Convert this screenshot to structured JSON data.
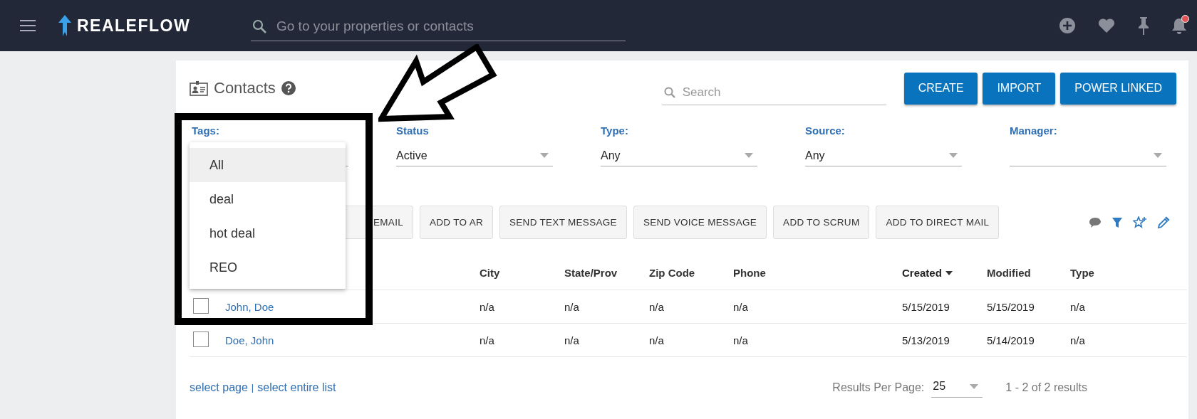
{
  "topbar": {
    "logo": "REALEFLOW",
    "search": {
      "placeholder": "Go to your properties or contacts"
    }
  },
  "page": {
    "title": "Contacts",
    "search": {
      "placeholder": "Search"
    },
    "buttons": [
      "CREATE",
      "IMPORT",
      "POWER LINKED"
    ],
    "filters": [
      {
        "label": "Tags:",
        "options": [
          {
            "label": "All",
            "selected": true
          },
          {
            "label": "deal",
            "selected": false
          },
          {
            "label": "hot deal",
            "selected": false
          },
          {
            "label": "REO",
            "selected": false
          }
        ]
      },
      {
        "label": "Status",
        "value": "Active"
      },
      {
        "label": "Type:",
        "value": "Any"
      },
      {
        "label": "Source:",
        "value": "Any"
      },
      {
        "label": "Manager:"
      }
    ],
    "actions": [
      "EMAIL",
      "ADD TO AR",
      "SEND TEXT MESSAGE",
      "SEND VOICE MESSAGE",
      "ADD TO SCRUM",
      "ADD TO DIRECT MAIL"
    ],
    "table": {
      "columns": [
        {},
        {
          "label": "City",
          "sorted": false
        },
        {
          "label": "State/Prov",
          "sorted": false
        },
        {
          "label": "Zip Code",
          "sorted": false
        },
        {
          "label": "Phone",
          "sorted": false
        },
        {
          "label": "Created",
          "sorted": true
        },
        {
          "label": "Modified",
          "sorted": false
        },
        {
          "label": "Type",
          "sorted": false
        }
      ],
      "rows": [
        {
          "checked": false,
          "cells": [
            "John, Doe",
            "n/a",
            "n/a",
            "n/a",
            "n/a",
            "5/15/2019",
            "5/15/2019",
            "n/a"
          ]
        },
        {
          "checked": false,
          "cells": [
            "Doe, John",
            "n/a",
            "n/a",
            "n/a",
            "n/a",
            "5/13/2019",
            "5/14/2019",
            "n/a"
          ]
        }
      ]
    },
    "footer": {
      "links": [
        "select page",
        "select entire list"
      ],
      "separator": "|",
      "per_page_label": "Results Per Page:",
      "per_page": "25",
      "summary": "1 - 2 of 2 results"
    }
  }
}
